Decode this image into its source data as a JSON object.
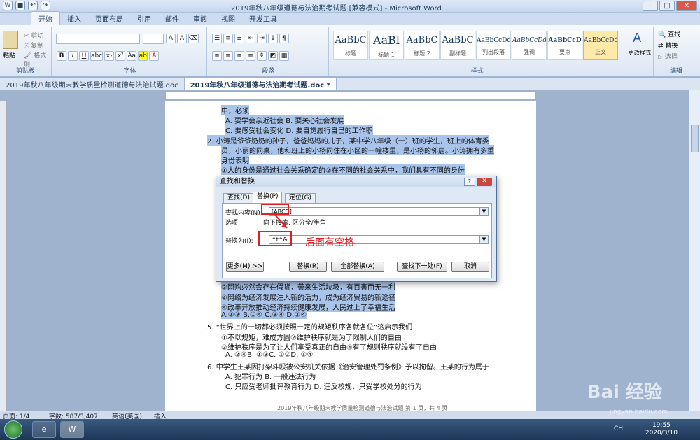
{
  "window": {
    "title": "2019年秋八年级道德与法治期考试题 [兼容模式] - Microsoft Word"
  },
  "ribbon_tabs": [
    "开始",
    "插入",
    "页面布局",
    "引用",
    "邮件",
    "审阅",
    "视图",
    "开发工具"
  ],
  "ribbon": {
    "clipboard": {
      "paste": "粘贴",
      "cut": "剪切",
      "copy": "复制",
      "format_painter": "格式刷",
      "label": "剪贴板"
    },
    "font_label": "字体",
    "paragraph_label": "段落",
    "styles_label": "样式",
    "editing_label": "编辑",
    "styles": [
      {
        "preview": "AaBbC",
        "name": "标题"
      },
      {
        "preview": "AaBl",
        "name": "标题 1"
      },
      {
        "preview": "AaBbC",
        "name": "标题 2"
      },
      {
        "preview": "AaBbC",
        "name": "副标题"
      },
      {
        "preview": "AaBbCcDd",
        "name": "列出段落"
      },
      {
        "preview": "AaBbCcDd",
        "name": "强调"
      },
      {
        "preview": "AaBbCcD",
        "name": "要点"
      },
      {
        "preview": "AaBbCcDd",
        "name": "正文"
      }
    ],
    "change_styles": "更改样式",
    "find": "查找",
    "replace": "替换",
    "select": "选择"
  },
  "doc_tabs": [
    "2019年秋八年级期末教学质量检测道德与法治试题.doc",
    "2019年秋八年级道德与法治期考试题.doc *"
  ],
  "document_lines": [
    {
      "text": "中，必须",
      "hl": true
    },
    {
      "text": "A. 要学会亲近社会 B. 要关心社会发展",
      "hl": true
    },
    {
      "text": "C. 要感受社会变化 D. 要自觉履行自己的工作职",
      "hl": true
    },
    {
      "text": "2. 小涛是爷爷奶奶的孙子，爸爸妈妈的儿子，某中学八年级（一）班的学生，班上的体育委",
      "hl": true
    },
    {
      "text": "员，小丽的同桌，他和班上的小杨同住在小区的一幢楼里，是小杨的邻居。小涛拥有多重",
      "hl": true
    },
    {
      "text": "身份表明",
      "hl": true
    },
    {
      "text": "①人的身份是通过社会关系确定的②在不同的社会关系中，我们具有不同的身份",
      "hl": true
    },
    {
      "text": "③网购必然会存在假货，带来生活垃圾，有百害而无一利",
      "hl": true
    },
    {
      "text": "④网络为经济发展注入新的活力，成为经济贸易的新途径",
      "hl": true
    },
    {
      "text": "④改革开放推动经济持续健康发展，人民过上了幸福生活",
      "hl": true
    },
    {
      "text": "A.①③  B.①④  C.③④  D.②④",
      "hl": true
    },
    {
      "text": "5. “世界上的一切都必须按照一定的规矩秩序各就各位”这启示我们",
      "hl": false
    },
    {
      "text": "①不以规矩，难成方圆②维护秩序就是为了限制人们的自由",
      "hl": false
    },
    {
      "text": "③维护秩序是为了让人们享受真正的自由④有了规则秩序就没有了自由",
      "hl": false
    },
    {
      "text": "A. ②④B. ①③C. ①②D. ①④",
      "hl": false
    },
    {
      "text": "6. 中学生王某因打架斗殴被公安机关依据《治安管理处罚条例》予以拘留。王某的行为属于",
      "hl": false
    },
    {
      "text": "A. 犯罪行为 B. 一般违法行为",
      "hl": false
    },
    {
      "text": "C. 只应受老师批评教育行为 D. 违反校规，只受学校处分的行为",
      "hl": false
    },
    {
      "text": "2019年秋八年级期末教学质量检测道德与法治试题  第 1 页，共 4 页",
      "hl": false
    }
  ],
  "dialog": {
    "title": "查找和替换",
    "tabs": [
      "查找(D)",
      "替换(P)",
      "定位(G)"
    ],
    "find_label": "查找内容(N):",
    "find_value": "[ABCD]",
    "options_label": "选项:",
    "options_value": "向下搜索, 区分全/半角",
    "replace_label": "替换为(I):",
    "replace_value": "^t^&",
    "buttons": {
      "more": "更多(M) >>",
      "replace": "替换(R)",
      "replace_all": "全部替换(A)",
      "find_next": "查找下一处(F)",
      "cancel": "取消"
    }
  },
  "annotation": "后面有空格",
  "status": {
    "page": "页面: 1/4",
    "words": "字数: 587/3,407",
    "lang": "英语(美国)",
    "insert": "插入"
  },
  "tray": {
    "ime": "CH",
    "time": "19:55",
    "date": "2020/3/10"
  },
  "watermark": {
    "logo": "Bai 经验",
    "url": "jingyan.baidu.com"
  },
  "accent": "#e02020"
}
